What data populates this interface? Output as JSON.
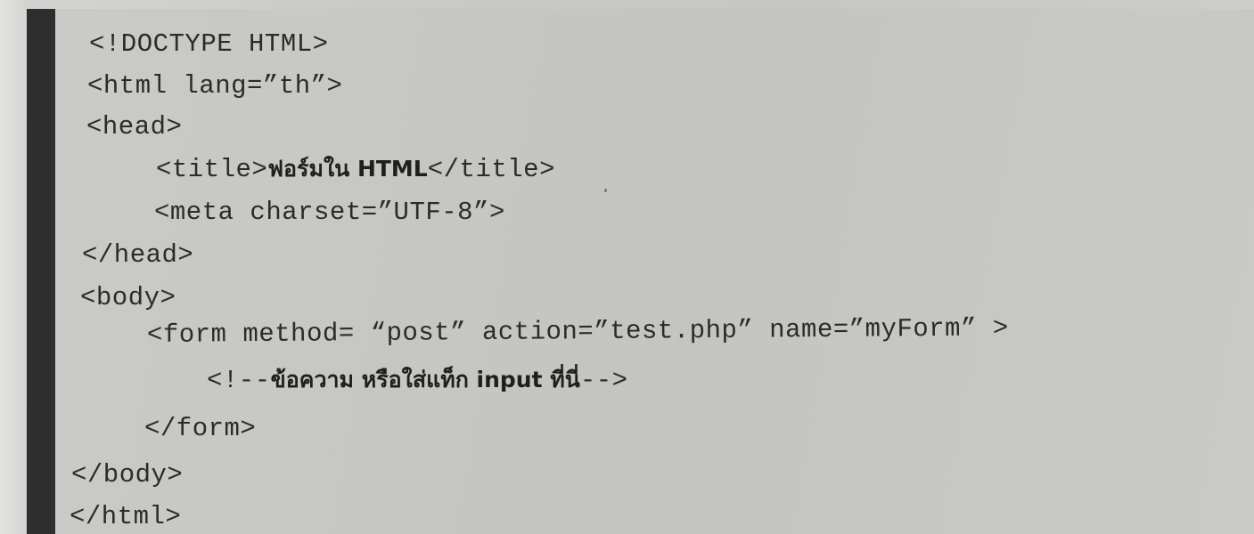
{
  "code": {
    "lines": [
      {
        "text": "<!DOCTYPE HTML>"
      },
      {
        "text": "<html lang=”th”>"
      },
      {
        "text": "<head>"
      },
      {
        "pre": "<title>",
        "thai": "ฟอร์มใน HTML",
        "post": "</title>"
      },
      {
        "text": "<meta charset=”UTF-8”>"
      },
      {
        "text": "</head>"
      },
      {
        "text": "<body>"
      },
      {
        "text": "<form method= “post” action=”test.php” name=”myForm” >"
      },
      {
        "pre": "<!--",
        "thai": "ข้อความ หรือใส่แท็ก input ที่นี่",
        "post": "-->"
      },
      {
        "text": "</form>"
      },
      {
        "text": "</body>"
      },
      {
        "text": "</html>"
      }
    ]
  }
}
